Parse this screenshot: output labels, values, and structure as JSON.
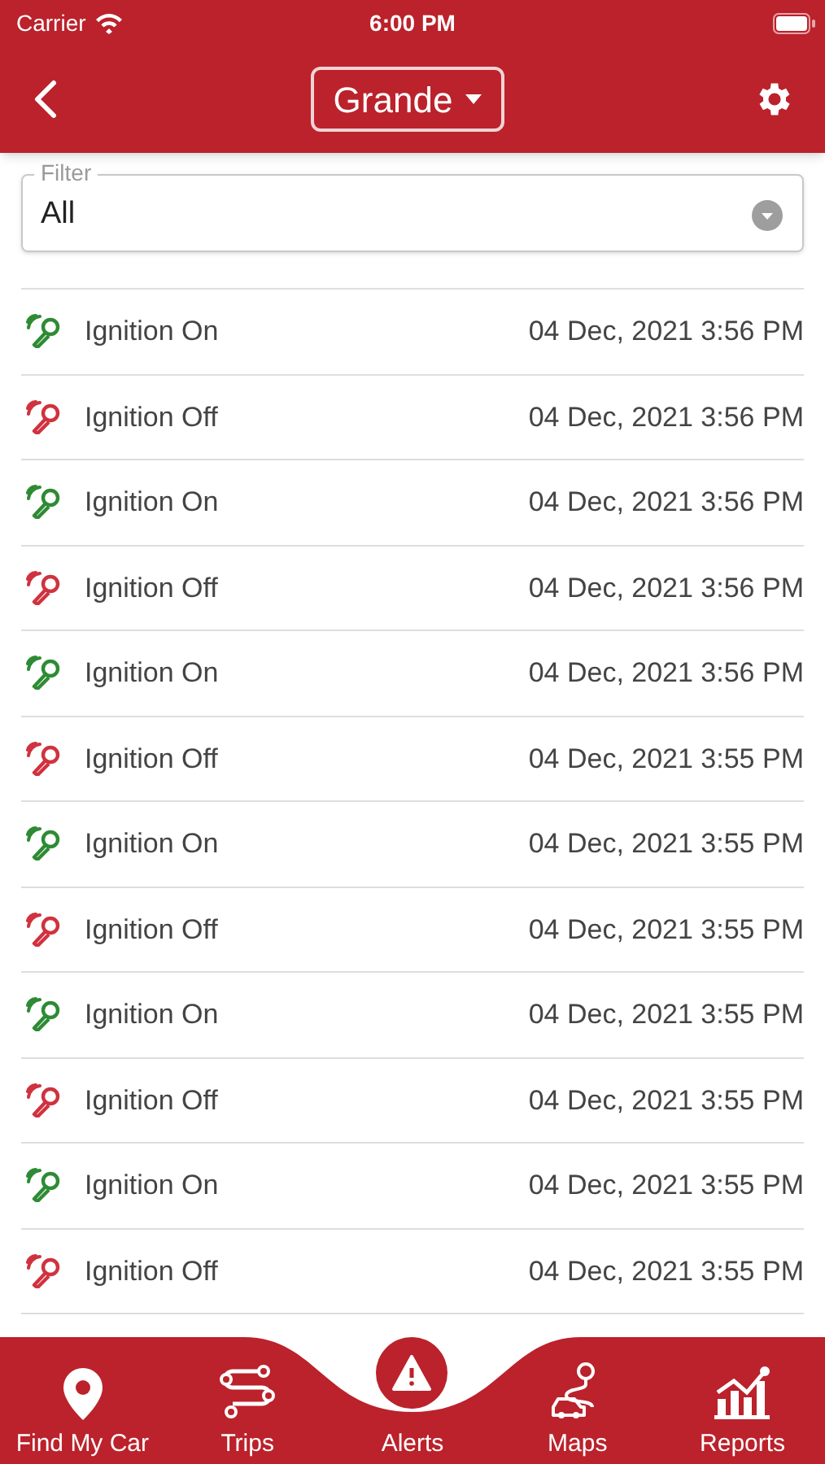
{
  "status_bar": {
    "carrier": "Carrier",
    "time": "6:00 PM"
  },
  "header": {
    "title": "Grande"
  },
  "filter": {
    "label": "Filter",
    "value": "All"
  },
  "alerts": [
    {
      "kind": "on",
      "label": "Ignition On",
      "time": "04 Dec, 2021 3:56 PM"
    },
    {
      "kind": "off",
      "label": "Ignition Off",
      "time": "04 Dec, 2021 3:56 PM"
    },
    {
      "kind": "on",
      "label": "Ignition On",
      "time": "04 Dec, 2021 3:56 PM"
    },
    {
      "kind": "off",
      "label": "Ignition Off",
      "time": "04 Dec, 2021 3:56 PM"
    },
    {
      "kind": "on",
      "label": "Ignition On",
      "time": "04 Dec, 2021 3:56 PM"
    },
    {
      "kind": "off",
      "label": "Ignition Off",
      "time": "04 Dec, 2021 3:55 PM"
    },
    {
      "kind": "on",
      "label": "Ignition On",
      "time": "04 Dec, 2021 3:55 PM"
    },
    {
      "kind": "off",
      "label": "Ignition Off",
      "time": "04 Dec, 2021 3:55 PM"
    },
    {
      "kind": "on",
      "label": "Ignition On",
      "time": "04 Dec, 2021 3:55 PM"
    },
    {
      "kind": "off",
      "label": "Ignition Off",
      "time": "04 Dec, 2021 3:55 PM"
    },
    {
      "kind": "on",
      "label": "Ignition On",
      "time": "04 Dec, 2021 3:55 PM"
    },
    {
      "kind": "off",
      "label": "Ignition Off",
      "time": "04 Dec, 2021 3:55 PM"
    }
  ],
  "tabs": [
    {
      "kind": "pin",
      "label": "Find My Car",
      "selected": false
    },
    {
      "kind": "route",
      "label": "Trips",
      "selected": false
    },
    {
      "kind": "alert",
      "label": "Alerts",
      "selected": true
    },
    {
      "kind": "map",
      "label": "Maps",
      "selected": false
    },
    {
      "kind": "chart",
      "label": "Reports",
      "selected": false
    }
  ]
}
